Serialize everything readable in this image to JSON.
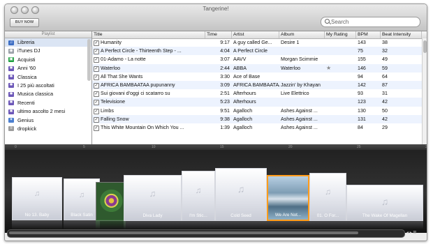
{
  "window": {
    "title": "Tangerine!",
    "buy_now": "BUY NOW"
  },
  "search": {
    "placeholder": "Search"
  },
  "sidebar": {
    "header": "Playlist",
    "items": [
      {
        "label": "Libreria",
        "icon": "library-icon",
        "selected": true
      },
      {
        "label": "iTunes DJ",
        "icon": "dj-icon"
      },
      {
        "label": "Acquisti",
        "icon": "purchased-icon"
      },
      {
        "label": "Anni '60",
        "icon": "smart-playlist-icon"
      },
      {
        "label": "Classica",
        "icon": "smart-playlist-icon"
      },
      {
        "label": "I 25 più ascoltati",
        "icon": "smart-playlist-icon"
      },
      {
        "label": "Musica classica",
        "icon": "smart-playlist-icon"
      },
      {
        "label": "Recenti",
        "icon": "smart-playlist-icon"
      },
      {
        "label": "ultimo ascolto 2 mesi",
        "icon": "smart-playlist-icon"
      },
      {
        "label": "Genius",
        "icon": "genius-icon"
      },
      {
        "label": "dropkick",
        "icon": "playlist-icon"
      }
    ]
  },
  "table": {
    "columns": [
      "Title",
      "Time",
      "Artist",
      "Album",
      "My Rating",
      "BPM",
      "Beat Intensity"
    ],
    "rows": [
      {
        "title": "Humanity",
        "time": "9:17",
        "artist": "A guy called Ge...",
        "album": "Desire 1",
        "rating": "",
        "bpm": "143",
        "intensity": "38"
      },
      {
        "title": "A Perfect Circle - Thirteenth Step - ...",
        "time": "4:04",
        "artist": "A Perfect Circle",
        "album": "",
        "rating": "",
        "bpm": "75",
        "intensity": "32"
      },
      {
        "title": "01-Adamo - La notte",
        "time": "3:07",
        "artist": "AAVV",
        "album": "Morgan Scimmie",
        "rating": "",
        "bpm": "155",
        "intensity": "49"
      },
      {
        "title": "Waterloo",
        "time": "2:44",
        "artist": "ABBA",
        "album": "Waterloo",
        "rating": "★",
        "bpm": "146",
        "intensity": "59"
      },
      {
        "title": "All That She Wants",
        "time": "3:30",
        "artist": "Ace of Base",
        "album": "",
        "rating": "",
        "bpm": "94",
        "intensity": "64"
      },
      {
        "title": "AFRICA BAMBAATAA pupunanny",
        "time": "3:09",
        "artist": "AFRICA BAMBAATAA",
        "album": "Jazzin' by Khayan",
        "rating": "",
        "bpm": "142",
        "intensity": "87"
      },
      {
        "title": "Sui giovani d'oggi ci scatarro su",
        "time": "2:51",
        "artist": "Afterhours",
        "album": "Live Elettrico",
        "rating": "",
        "bpm": "93",
        "intensity": "31"
      },
      {
        "title": "Televisione",
        "time": "5:23",
        "artist": "Afterhours",
        "album": "",
        "rating": "",
        "bpm": "123",
        "intensity": "42"
      },
      {
        "title": "Limbs",
        "time": "9:51",
        "artist": "Agalloch",
        "album": "Ashes Against ...",
        "rating": "",
        "bpm": "130",
        "intensity": "50"
      },
      {
        "title": "Falling Snow",
        "time": "9:38",
        "artist": "Agalloch",
        "album": "Ashes Against ...",
        "rating": "",
        "bpm": "131",
        "intensity": "42"
      },
      {
        "title": "This White Mountain On Which You ...",
        "time": "1:39",
        "artist": "Agalloch",
        "album": "Ashes Against ...",
        "rating": "",
        "bpm": "84",
        "intensity": "29"
      }
    ]
  },
  "coverflow": {
    "ruler_ticks": [
      "0",
      "5",
      "10",
      "15",
      "20",
      "25",
      "30"
    ],
    "albums": [
      {
        "caption": "No 13. Baby"
      },
      {
        "caption": "Black Satin"
      },
      {
        "caption": ""
      },
      {
        "caption": "Diva Lady"
      },
      {
        "caption": "I'm Stic..."
      },
      {
        "caption": "Cold Seed"
      },
      {
        "caption": "We Are Not..."
      },
      {
        "caption": "01. O For..."
      },
      {
        "caption": "The Wake Of Magellan"
      }
    ],
    "selected_index": 6
  },
  "colors": {
    "selection": "#dbe5f4",
    "row_stripe": "#edf3fe",
    "accent": "#ff9c1a"
  }
}
